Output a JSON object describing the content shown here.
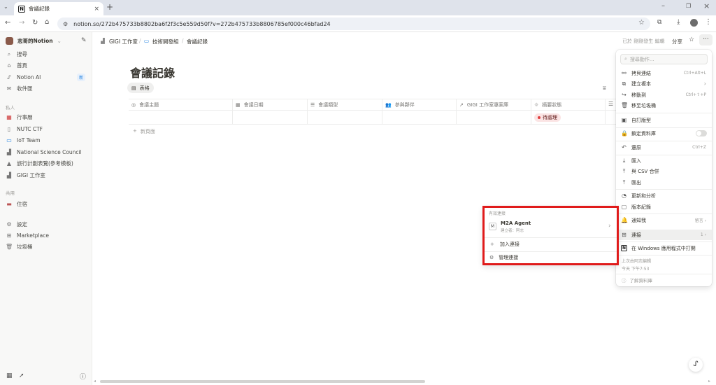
{
  "browser": {
    "tab_title": "會議記錄",
    "url": "notion.so/272b475733b8802ba6f2f3c5e559d50f?v=272b475733b8806785ef000c46bfad24"
  },
  "sidebar": {
    "workspace": "志哥的Notion",
    "top_items": [
      {
        "icon": "search-icon",
        "label": "搜尋"
      },
      {
        "icon": "home-icon",
        "label": "首頁"
      },
      {
        "icon": "notion-ai-icon",
        "label": "Notion AI",
        "badge": "新"
      },
      {
        "icon": "inbox-icon",
        "label": "收件匣"
      }
    ],
    "private_header": "私人",
    "private_items": [
      "行事曆",
      "NUTC CTF",
      "IoT Team",
      "National Science Council",
      "旅行計劃表覽(參考模板)",
      "GIGI 工作室"
    ],
    "shared_header": "共用",
    "shared_items": [
      "住宿"
    ],
    "bottom_items": [
      "設定",
      "Marketplace",
      "垃圾桶"
    ]
  },
  "topbar": {
    "crumbs": [
      "GIGI 工作室",
      "技術開發組",
      "會議記錄"
    ],
    "edited_text": "已於 剛剛發生 編輯",
    "share_label": "分享"
  },
  "database": {
    "title": "會議記錄",
    "view_tab": "表格",
    "columns": [
      "會議主題",
      "會議日期",
      "會議類型",
      "參與夥伴",
      "GIGI 工作室專案庫",
      "摘要狀態"
    ],
    "row_status": "待處理",
    "new_page": "新頁面"
  },
  "menu": {
    "search_placeholder": "搜尋動作...",
    "items": [
      {
        "icon": "link-icon",
        "label": "拷貝連結",
        "shortcut": "Ctrl+Alt+L"
      },
      {
        "icon": "copy-icon",
        "label": "建立複本",
        "shortcut": "›"
      },
      {
        "icon": "move-icon",
        "label": "移動到",
        "shortcut": "Ctrl+⇧+P"
      },
      {
        "icon": "trash-icon",
        "label": "移至垃圾桶",
        "shortcut": ""
      },
      {
        "icon": "layout-icon",
        "label": "自訂版型",
        "shortcut": ""
      },
      {
        "icon": "lock-icon",
        "label": "鎖定資料庫",
        "shortcut": ""
      },
      {
        "icon": "undo-icon",
        "label": "還原",
        "shortcut": "Ctrl+Z"
      },
      {
        "icon": "import-icon",
        "label": "匯入",
        "shortcut": ""
      },
      {
        "icon": "merge-icon",
        "label": "與 CSV 合併",
        "shortcut": ""
      },
      {
        "icon": "export-icon",
        "label": "匯出",
        "shortcut": ""
      },
      {
        "icon": "analytics-icon",
        "label": "更新和分析",
        "shortcut": ""
      },
      {
        "icon": "history-icon",
        "label": "版本紀錄",
        "shortcut": ""
      },
      {
        "icon": "bell-icon",
        "label": "通知我",
        "shortcut": "留言 ›"
      },
      {
        "icon": "connections-icon",
        "label": "連接",
        "shortcut": "1 ›"
      },
      {
        "icon": "notion-app-icon",
        "label": "在 Windows 應用程式中打開",
        "shortcut": ""
      }
    ],
    "last_edited_label": "上次由阿志編輯",
    "last_edited_time": "今天 下午7:53",
    "learn_label": "了解資料庫"
  },
  "connections": {
    "header": "有效連接",
    "agent_name": "M2A Agent",
    "agent_sub": "建立者：阿志",
    "agent_avatar": "M",
    "add_label": "加入連接",
    "manage_label": "管理連接"
  },
  "colors": {
    "highlight_border": "#e01b1b",
    "status_bg": "#fbe4e4",
    "status_dot": "#e03e3e",
    "badge_bg": "#e7f0fb",
    "badge_text": "#2383e2"
  }
}
